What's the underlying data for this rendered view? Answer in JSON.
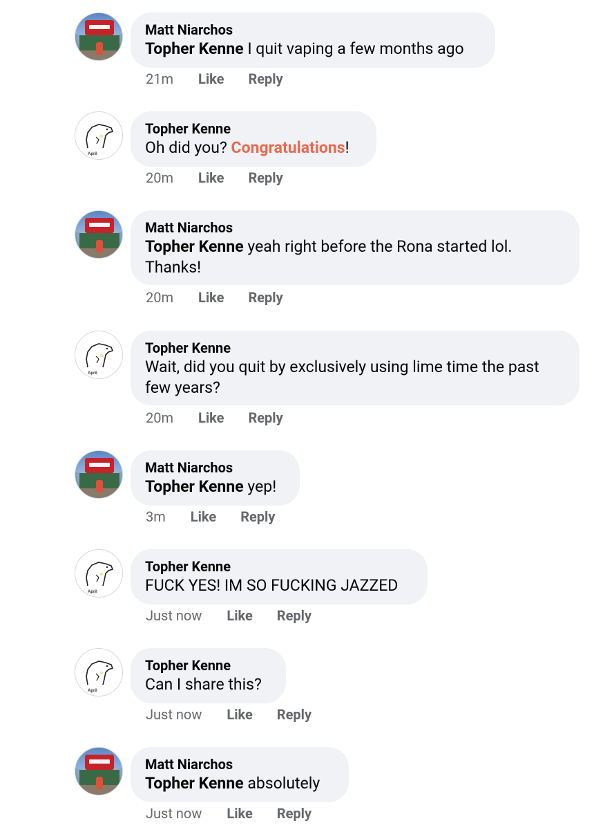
{
  "comments": [
    {
      "author": "Matt Niarchos",
      "tag": "Topher Kenne",
      "text": " I quit vaping a few months ago",
      "time": "21m",
      "like": "Like",
      "reply": "Reply",
      "avatar": "stadium"
    },
    {
      "author": "Topher Kenne",
      "text_before": "Oh did you? ",
      "highlight": "Congratulations",
      "text_after": "!",
      "time": "20m",
      "like": "Like",
      "reply": "Reply",
      "avatar": "sketch",
      "avatar_caption": "April"
    },
    {
      "author": "Matt Niarchos",
      "tag": "Topher Kenne",
      "text": " yeah right before the Rona started lol.",
      "text_line2": "Thanks!",
      "time": "20m",
      "like": "Like",
      "reply": "Reply",
      "avatar": "stadium"
    },
    {
      "author": "Topher Kenne",
      "text": "Wait, did you quit by exclusively using lime time the past",
      "text_line2": "few years?",
      "time": "20m",
      "like": "Like",
      "reply": "Reply",
      "avatar": "sketch",
      "avatar_caption": "April"
    },
    {
      "author": "Matt Niarchos",
      "tag": "Topher Kenne",
      "text": " yep!",
      "time": "3m",
      "like": "Like",
      "reply": "Reply",
      "avatar": "stadium"
    },
    {
      "author": "Topher Kenne",
      "text": "FUCK YES! IM SO FUCKING JAZZED",
      "time": "Just now",
      "like": "Like",
      "reply": "Reply",
      "avatar": "sketch",
      "avatar_caption": "April"
    },
    {
      "author": "Topher Kenne",
      "text": "Can I share this?",
      "time": "Just now",
      "like": "Like",
      "reply": "Reply",
      "avatar": "sketch",
      "avatar_caption": "April"
    },
    {
      "author": "Matt Niarchos",
      "tag": "Topher Kenne",
      "text": " absolutely",
      "time": "Just now",
      "like": "Like",
      "reply": "Reply",
      "avatar": "stadium"
    }
  ],
  "colors": {
    "bubble": "#f0f2f5",
    "meta": "#65676b",
    "highlight": "#e86a4f"
  }
}
